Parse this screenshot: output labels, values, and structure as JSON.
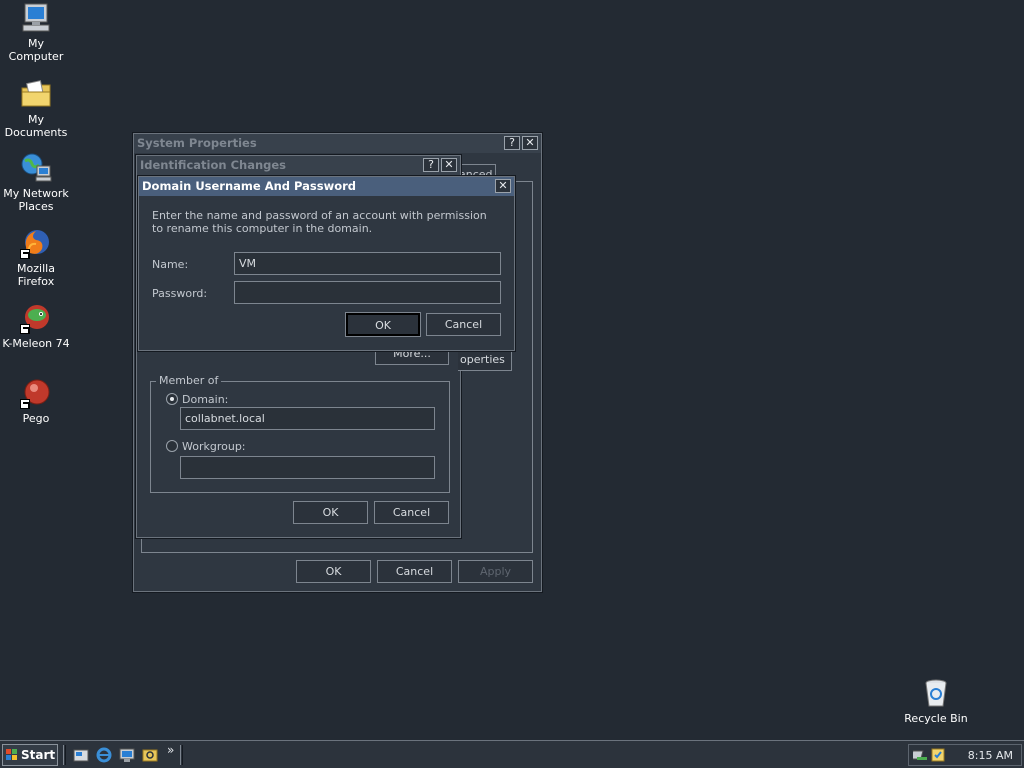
{
  "desktop": {
    "icons": [
      {
        "label": "My Computer",
        "icon": "my-computer-icon"
      },
      {
        "label": "My Documents",
        "icon": "my-documents-icon"
      },
      {
        "label": "My Network Places",
        "icon": "network-places-icon"
      },
      {
        "label": "Mozilla Firefox",
        "icon": "firefox-icon"
      },
      {
        "label": "K-Meleon 74",
        "icon": "k-meleon-icon"
      },
      {
        "label": "Pego",
        "icon": "pego-icon"
      },
      {
        "label": "Recycle Bin",
        "icon": "recycle-bin-icon"
      }
    ]
  },
  "system_properties": {
    "title": "System Properties",
    "help_label": "?",
    "close_label": "✕",
    "tab_fragment": "anced",
    "ok_label": "OK",
    "cancel_label": "Cancel",
    "apply_label": "Apply"
  },
  "identification_changes": {
    "title": "Identification Changes",
    "help_label": "?",
    "close_label": "✕",
    "more_label": "More...",
    "properties_fragment": "operties",
    "member_of_label": "Member of",
    "domain_label": "Domain:",
    "domain_value": "collabnet.local",
    "workgroup_label": "Workgroup:",
    "workgroup_value": "",
    "selected": "domain",
    "ok_label": "OK",
    "cancel_label": "Cancel"
  },
  "domain_dialog": {
    "title": "Domain Username And Password",
    "close_label": "✕",
    "description": "Enter the name and password of an account with permission to rename this computer in the domain.",
    "name_label": "Name:",
    "name_value": "VM",
    "password_label": "Password:",
    "password_value": "",
    "ok_label": "OK",
    "cancel_label": "Cancel"
  },
  "taskbar": {
    "start_label": "Start",
    "chevron": "»",
    "clock": "8:15 AM"
  },
  "colors": {
    "desktop": "#232a33",
    "active_title": "#4a5f7c",
    "window_bg": "#2f3741"
  }
}
